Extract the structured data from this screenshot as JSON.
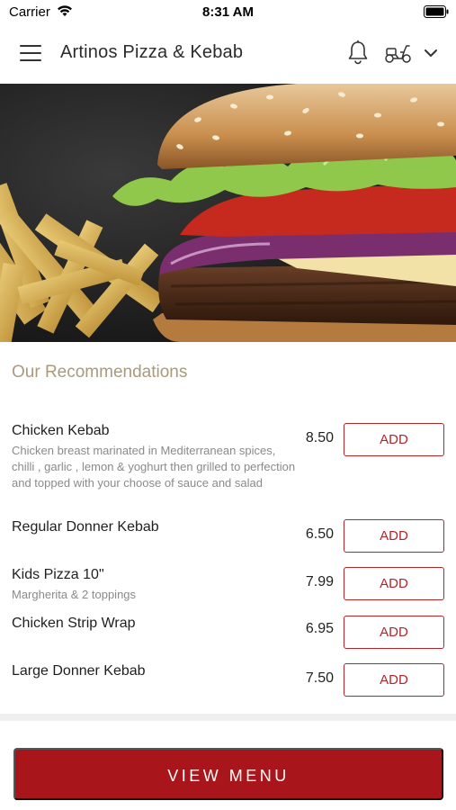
{
  "status_bar": {
    "carrier": "Carrier",
    "time": "8:31 AM"
  },
  "header": {
    "title": "Artinos Pizza & Kebab",
    "icons": [
      "menu-icon",
      "bell-icon",
      "scooter-icon",
      "chevron-down-icon"
    ]
  },
  "hero": {
    "image": "burger-and-fries-photo"
  },
  "recommendations": {
    "title": "Our Recommendations",
    "add_label": "ADD",
    "items": [
      {
        "name": "Chicken Kebab",
        "description": "Chicken breast marinated in Mediterranean spices, chilli , garlic , lemon & yoghurt then grilled to perfection and topped with your choose of sauce and salad",
        "price": "8.50"
      },
      {
        "name": "Regular Donner Kebab",
        "description": "",
        "price": "6.50"
      },
      {
        "name": "Kids Pizza 10\"",
        "description": "Margherita & 2 toppings",
        "price": "7.99"
      },
      {
        "name": "Chicken Strip Wrap",
        "description": "",
        "price": "6.95"
      },
      {
        "name": "Large Donner Kebab",
        "description": "",
        "price": "7.50"
      }
    ]
  },
  "footer": {
    "view_menu_label": "VIEW MENU"
  },
  "colors": {
    "accent": "#a8161b",
    "section_title": "#a99a7c"
  }
}
